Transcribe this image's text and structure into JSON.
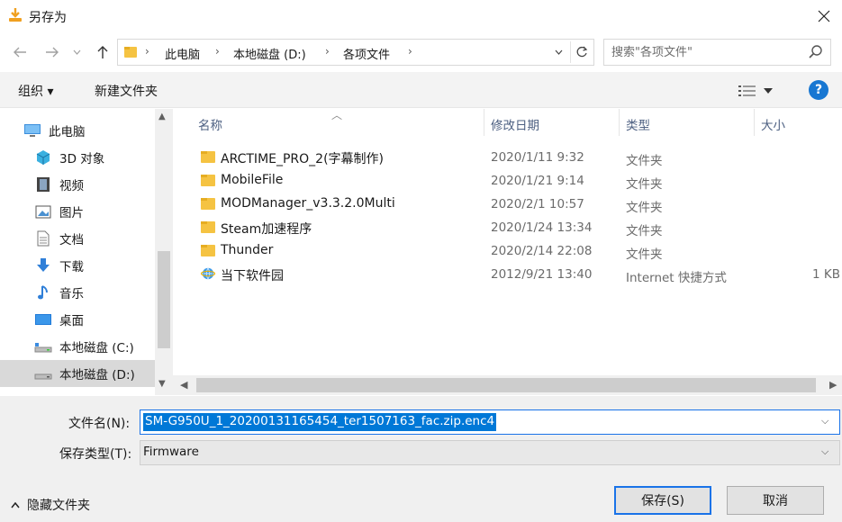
{
  "window": {
    "title": "另存为"
  },
  "address": {
    "crumbs": [
      "此电脑",
      "本地磁盘 (D:)",
      "各项文件"
    ]
  },
  "search": {
    "placeholder": "搜索\"各项文件\""
  },
  "toolbar": {
    "organize": "组织 ▾",
    "new_folder": "新建文件夹",
    "help": "?"
  },
  "nav": {
    "items": [
      {
        "label": "此电脑",
        "icon": "computer-icon"
      },
      {
        "label": "3D 对象",
        "icon": "cube-icon"
      },
      {
        "label": "视频",
        "icon": "video-icon"
      },
      {
        "label": "图片",
        "icon": "picture-icon"
      },
      {
        "label": "文档",
        "icon": "document-icon"
      },
      {
        "label": "下载",
        "icon": "download-icon"
      },
      {
        "label": "音乐",
        "icon": "music-icon"
      },
      {
        "label": "桌面",
        "icon": "desktop-icon"
      },
      {
        "label": "本地磁盘 (C:)",
        "icon": "drive-icon"
      },
      {
        "label": "本地磁盘 (D:)",
        "icon": "drive-icon",
        "selected": true
      }
    ]
  },
  "columns": {
    "name": "名称",
    "date": "修改日期",
    "type": "类型",
    "size": "大小"
  },
  "files": [
    {
      "name": "ARCTIME_PRO_2(字幕制作)",
      "date": "2020/1/11 9:32",
      "type": "文件夹",
      "size": "",
      "icon": "folder-icon"
    },
    {
      "name": "MobileFile",
      "date": "2020/1/21 9:14",
      "type": "文件夹",
      "size": "",
      "icon": "folder-icon"
    },
    {
      "name": "MODManager_v3.3.2.0Multi",
      "date": "2020/2/1 10:57",
      "type": "文件夹",
      "size": "",
      "icon": "folder-icon"
    },
    {
      "name": "Steam加速程序",
      "date": "2020/1/24 13:34",
      "type": "文件夹",
      "size": "",
      "icon": "folder-icon"
    },
    {
      "name": "Thunder",
      "date": "2020/2/14 22:08",
      "type": "文件夹",
      "size": "",
      "icon": "folder-icon"
    },
    {
      "name": "当下软件园",
      "date": "2012/9/21 13:40",
      "type": "Internet 快捷方式",
      "size": "1 KB",
      "icon": "internet-shortcut-icon"
    }
  ],
  "form": {
    "filename_label": "文件名(N):",
    "filename_value": "SM-G950U_1_20200131165454_ter1507163_fac.zip.enc4",
    "filetype_label": "保存类型(T):",
    "filetype_value": "Firmware",
    "hide_folders": "隐藏文件夹",
    "save": "保存(S)",
    "cancel": "取消"
  },
  "colors": {
    "accent": "#1a73e8",
    "selection": "#0078d7",
    "folder": "#f5c342"
  }
}
